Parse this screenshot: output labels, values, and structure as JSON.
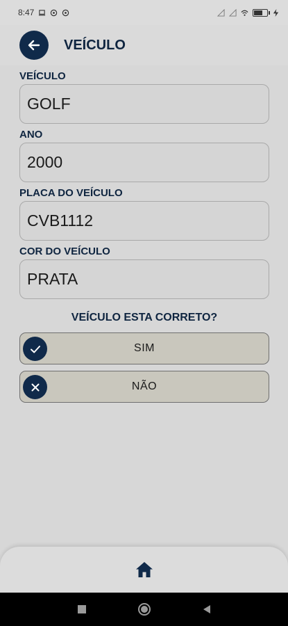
{
  "status_bar": {
    "time": "8:47"
  },
  "header": {
    "title": "VEÍCULO"
  },
  "fields": [
    {
      "label": "VEÍCULO",
      "value": "GOLF"
    },
    {
      "label": "ANO",
      "value": "2000"
    },
    {
      "label": "PLACA DO VEÍCULO",
      "value": "CVB1112"
    },
    {
      "label": "COR DO VEÍCULO",
      "value": "PRATA"
    }
  ],
  "question": "VEÍCULO ESTA CORRETO?",
  "choices": {
    "yes": {
      "label": "SIM",
      "icon": "check-icon"
    },
    "no": {
      "label": "NÃO",
      "icon": "close-icon"
    }
  },
  "bottom_nav": {
    "icon": "home-icon"
  },
  "colors": {
    "primary": "#102a4a",
    "choice_bg": "#c9c7bd",
    "page_bg": "#d7d7d7"
  }
}
